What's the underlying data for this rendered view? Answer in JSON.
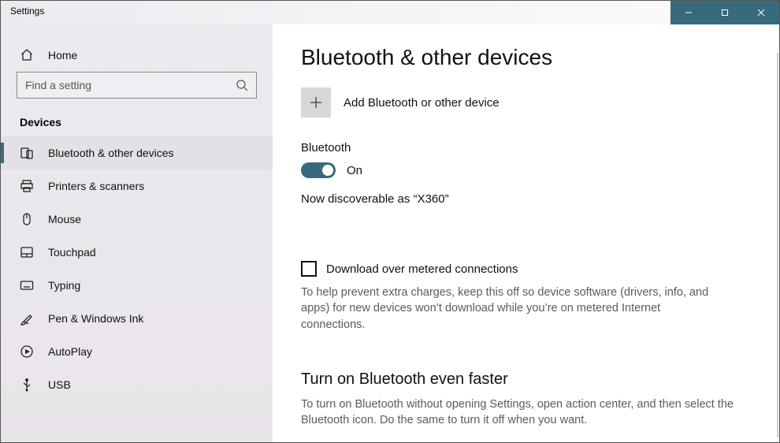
{
  "window": {
    "title": "Settings"
  },
  "sidebar": {
    "home_label": "Home",
    "search_placeholder": "Find a setting",
    "section": "Devices",
    "items": [
      {
        "label": "Bluetooth & other devices",
        "icon": "bluetooth-devices-icon",
        "selected": true
      },
      {
        "label": "Printers & scanners",
        "icon": "printer-icon",
        "selected": false
      },
      {
        "label": "Mouse",
        "icon": "mouse-icon",
        "selected": false
      },
      {
        "label": "Touchpad",
        "icon": "touchpad-icon",
        "selected": false
      },
      {
        "label": "Typing",
        "icon": "keyboard-icon",
        "selected": false
      },
      {
        "label": "Pen & Windows Ink",
        "icon": "pen-icon",
        "selected": false
      },
      {
        "label": "AutoPlay",
        "icon": "autoplay-icon",
        "selected": false
      },
      {
        "label": "USB",
        "icon": "usb-icon",
        "selected": false
      }
    ]
  },
  "page": {
    "title": "Bluetooth & other devices",
    "add_device_label": "Add Bluetooth or other device",
    "bluetooth_label": "Bluetooth",
    "bluetooth_on": true,
    "bluetooth_state_text": "On",
    "discoverable_text": "Now discoverable as “X360”",
    "metered_checkbox_label": "Download over metered connections",
    "metered_checked": false,
    "metered_help": "To help prevent extra charges, keep this off so device software (drivers, info, and apps) for new devices won’t download while you’re on metered Internet connections.",
    "tip_title": "Turn on Bluetooth even faster",
    "tip_body": "To turn on Bluetooth without opening Settings, open action center, and then select the Bluetooth icon. Do the same to turn it off when you want."
  },
  "colors": {
    "accent": "#386a7d"
  }
}
